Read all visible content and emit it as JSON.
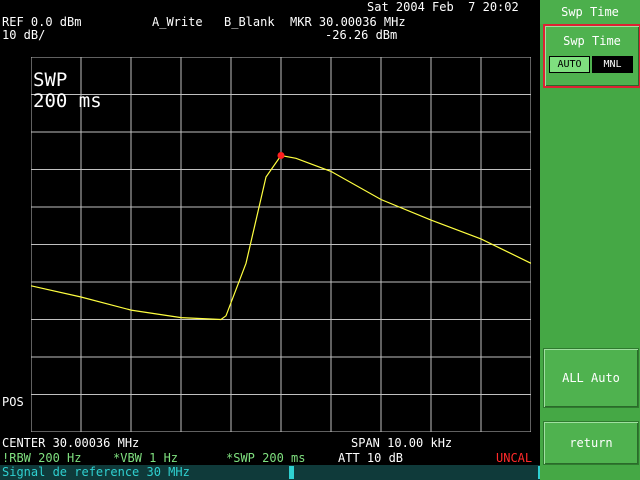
{
  "header": {
    "datetime": "Sat 2004 Feb  7 20:02",
    "ref": "REF 0.0 dBm",
    "scale": "10 dB/",
    "trace_a": "A_Write",
    "trace_b": "B_Blank",
    "marker_freq": "MKR 30.00036 MHz",
    "marker_level": "-26.26 dBm"
  },
  "plot": {
    "swp_label": "SWP",
    "swp_value": "200 ms",
    "pos_label": "POS"
  },
  "footer": {
    "center": "CENTER 30.00036 MHz",
    "span": "SPAN 10.00 kHz",
    "rbw": "!RBW 200 Hz",
    "vbw": "*VBW 1 Hz",
    "swp": "*SWP 200 ms",
    "att": "ATT 10 dB",
    "uncal": "UNCAL"
  },
  "status": {
    "message": "Signal de reference 30 MHz"
  },
  "sidebar": {
    "title": "Swp Time",
    "swp_time_label": "Swp Time",
    "auto_label": "AUTO",
    "mnl_label": "MNL",
    "mode_selected": "MNL",
    "all_auto_label": "ALL Auto",
    "return_label": "return"
  },
  "colors": {
    "trace": "#ffff40",
    "marker": "#ff2020",
    "grid": "#c0c0c0",
    "sidebar": "#45a845"
  },
  "chart_data": {
    "type": "line",
    "grid": true,
    "x_divisions": 10,
    "y_divisions": 10,
    "ylim": [
      -100,
      0
    ],
    "x_div": [
      0,
      1,
      2,
      3,
      3.8,
      3.9,
      4.3,
      4.7,
      5.0,
      5.3,
      6.0,
      7.0,
      8.0,
      9.0,
      10.0
    ],
    "y_dBm": [
      -61.0,
      -64.0,
      -67.5,
      -69.5,
      -70.0,
      -69.0,
      -55.0,
      -32.0,
      -26.26,
      -27.0,
      -30.5,
      -38.0,
      -43.5,
      -48.5,
      -55.0
    ],
    "marker": {
      "x_div": 5.0,
      "y_dBm": -26.26
    }
  }
}
